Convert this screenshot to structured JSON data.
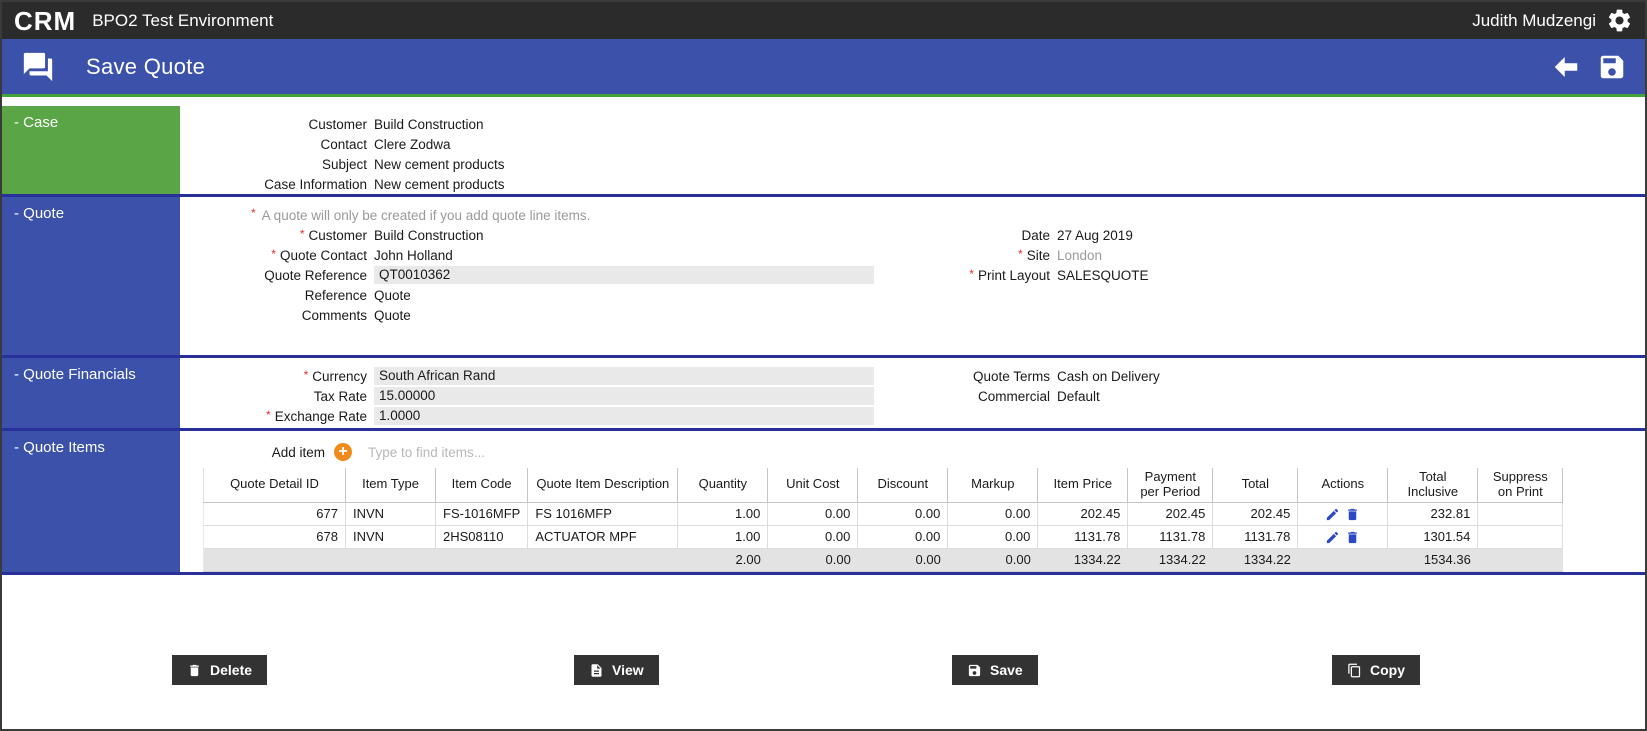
{
  "topbar": {
    "logo": "CRM",
    "title": "BPO2 Test Environment",
    "user": "Judith Mudzengi"
  },
  "header": {
    "title": "Save Quote"
  },
  "case_section": {
    "title": "Case",
    "fields": [
      {
        "label": "Customer",
        "value": "Build Construction"
      },
      {
        "label": "Contact",
        "value": "Clere Zodwa"
      },
      {
        "label": "Subject",
        "value": "New cement products"
      },
      {
        "label": "Case Information",
        "value": "New cement products"
      }
    ]
  },
  "quote_section": {
    "title": "Quote",
    "note": "A quote will only be created if you add quote line items.",
    "left_fields": [
      {
        "label": "Customer",
        "value": "Build Construction"
      },
      {
        "label": "Quote Contact",
        "value": "John Holland"
      },
      {
        "label": "Quote Reference",
        "value": "QT0010362"
      },
      {
        "label": "Reference",
        "value": "Quote"
      },
      {
        "label": "Comments",
        "value": "Quote"
      }
    ],
    "right_fields": [
      {
        "label": "Date",
        "value": "27 Aug 2019"
      },
      {
        "label": "Site",
        "value": "London"
      },
      {
        "label": "Print Layout",
        "value": "SALESQUOTE"
      }
    ]
  },
  "financials_section": {
    "title": "Quote Financials",
    "left_fields": [
      {
        "label": "Currency",
        "value": "South African Rand"
      },
      {
        "label": "Tax Rate",
        "value": "15.00000"
      },
      {
        "label": "Exchange Rate",
        "value": "1.0000"
      }
    ],
    "right_fields": [
      {
        "label": "Quote Terms",
        "value": "Cash on Delivery"
      },
      {
        "label": "Commercial",
        "value": "Default"
      }
    ]
  },
  "items_section": {
    "title": "Quote Items",
    "add_item_label": "Add item",
    "search_placeholder": "Type to find items...",
    "columns": [
      "Quote Detail ID",
      "Item Type",
      "Item Code",
      "Quote Item Description",
      "Quantity",
      "Unit Cost",
      "Discount",
      "Markup",
      "Item Price",
      "Payment per Period",
      "Total",
      "Actions",
      "Total Inclusive",
      "Suppress on Print"
    ],
    "rows": [
      {
        "id": "677",
        "item_type": "INVN",
        "item_code": "FS-1016MFP",
        "description": "FS 1016MFP",
        "quantity": "1.00",
        "unit_cost": "0.00",
        "discount": "0.00",
        "markup": "0.00",
        "item_price": "202.45",
        "payment_per_period": "202.45",
        "total": "202.45",
        "total_inclusive": "232.81",
        "suppress": ""
      },
      {
        "id": "678",
        "item_type": "INVN",
        "item_code": "2HS08110",
        "description": "ACTUATOR MPF",
        "quantity": "1.00",
        "unit_cost": "0.00",
        "discount": "0.00",
        "markup": "0.00",
        "item_price": "1131.78",
        "payment_per_period": "1131.78",
        "total": "1131.78",
        "total_inclusive": "1301.54",
        "suppress": ""
      }
    ],
    "totals": {
      "quantity": "2.00",
      "unit_cost": "0.00",
      "discount": "0.00",
      "markup": "0.00",
      "item_price": "1334.22",
      "payment_per_period": "1334.22",
      "total": "1334.22",
      "total_inclusive": "1534.36"
    }
  },
  "footer": {
    "delete_label": "Delete",
    "view_label": "View",
    "save_label": "Save",
    "copy_label": "Copy"
  },
  "colors": {
    "accent_blue": "#3c51a9",
    "accent_green": "#5aa545",
    "topbar_dark": "#2b2b2b",
    "add_button_orange": "#f08a1d",
    "action_icon_blue": "#2b49c6"
  }
}
